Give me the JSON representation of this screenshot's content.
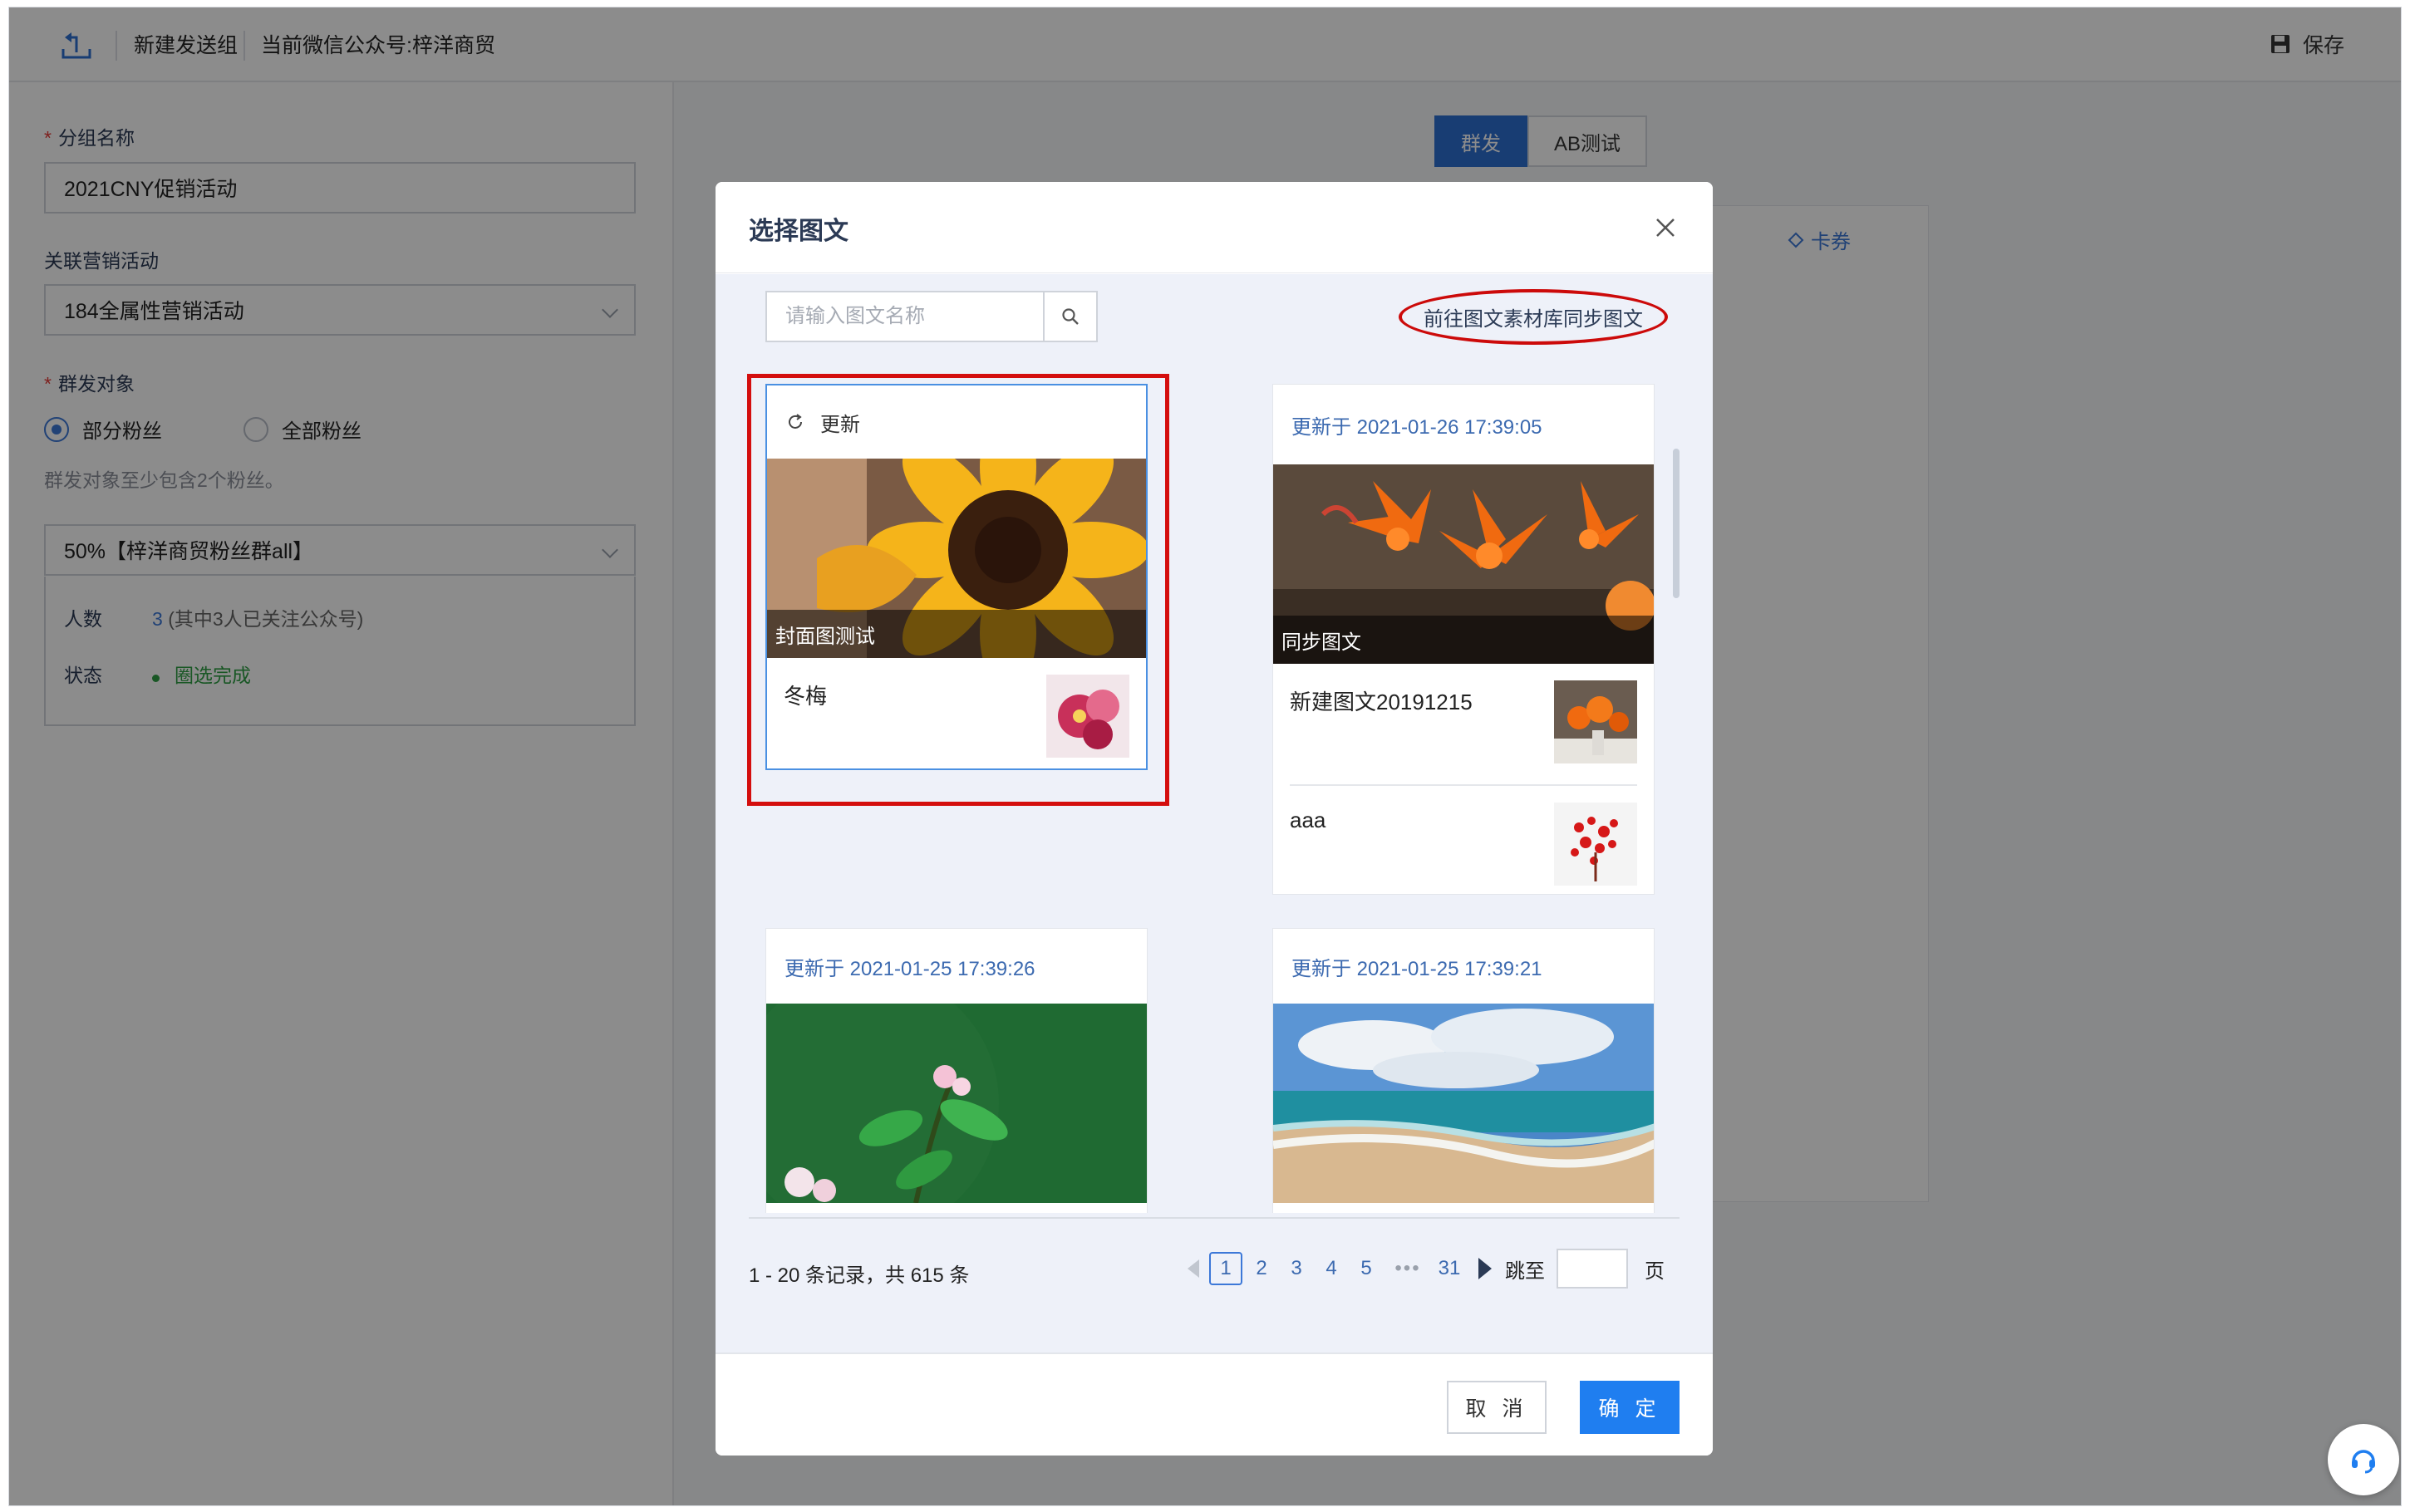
{
  "topbar": {
    "group_title": "新建发送组",
    "account": "当前微信公众号:梓洋商贸",
    "save_label": "保存"
  },
  "form": {
    "group_name_label": "分组名称",
    "group_name_value": "2021CNY促销活动",
    "campaign_label": "关联营销活动",
    "campaign_value": "184全属性营销活动",
    "target_label": "群发对象",
    "radio_partial": "部分粉丝",
    "radio_all": "全部粉丝",
    "hint": "群发对象至少包含2个粉丝。",
    "segment_value": "50%【梓洋商贸粉丝群all】",
    "count_label": "人数",
    "count_value": "3",
    "count_note": "(其中3人已关注公众号)",
    "status_label": "状态",
    "status_value": "圈选完成"
  },
  "background": {
    "tab_mass": "群发",
    "tab_ab": "AB测试",
    "coupon_tab": "卡券"
  },
  "modal": {
    "title": "选择图文",
    "search_placeholder": "请输入图文名称",
    "sync_link": "前往图文素材库同步图文",
    "cards": [
      {
        "header": "更新",
        "cover_caption": "封面图测试",
        "items": [
          "冬梅"
        ]
      },
      {
        "header": "更新于 2021-01-26 17:39:05",
        "cover_caption": "同步图文",
        "items": [
          "新建图文20191215",
          "aaa"
        ]
      },
      {
        "header": "更新于 2021-01-25 17:39:26"
      },
      {
        "header": "更新于 2021-01-25 17:39:21"
      }
    ],
    "pagination": {
      "summary": "1 - 20 条记录，共 615 条",
      "pages": [
        "1",
        "2",
        "3",
        "4",
        "5"
      ],
      "ellipsis": "•••",
      "last_page": "31",
      "jump_label": "跳至",
      "page_unit": "页"
    },
    "cancel_label": "取 消",
    "ok_label": "确 定"
  },
  "colors": {
    "accent": "#2d6fd2",
    "primary_button": "#1f7ef0",
    "highlight_red": "#d40e0e",
    "status_green": "#2e9e44"
  }
}
